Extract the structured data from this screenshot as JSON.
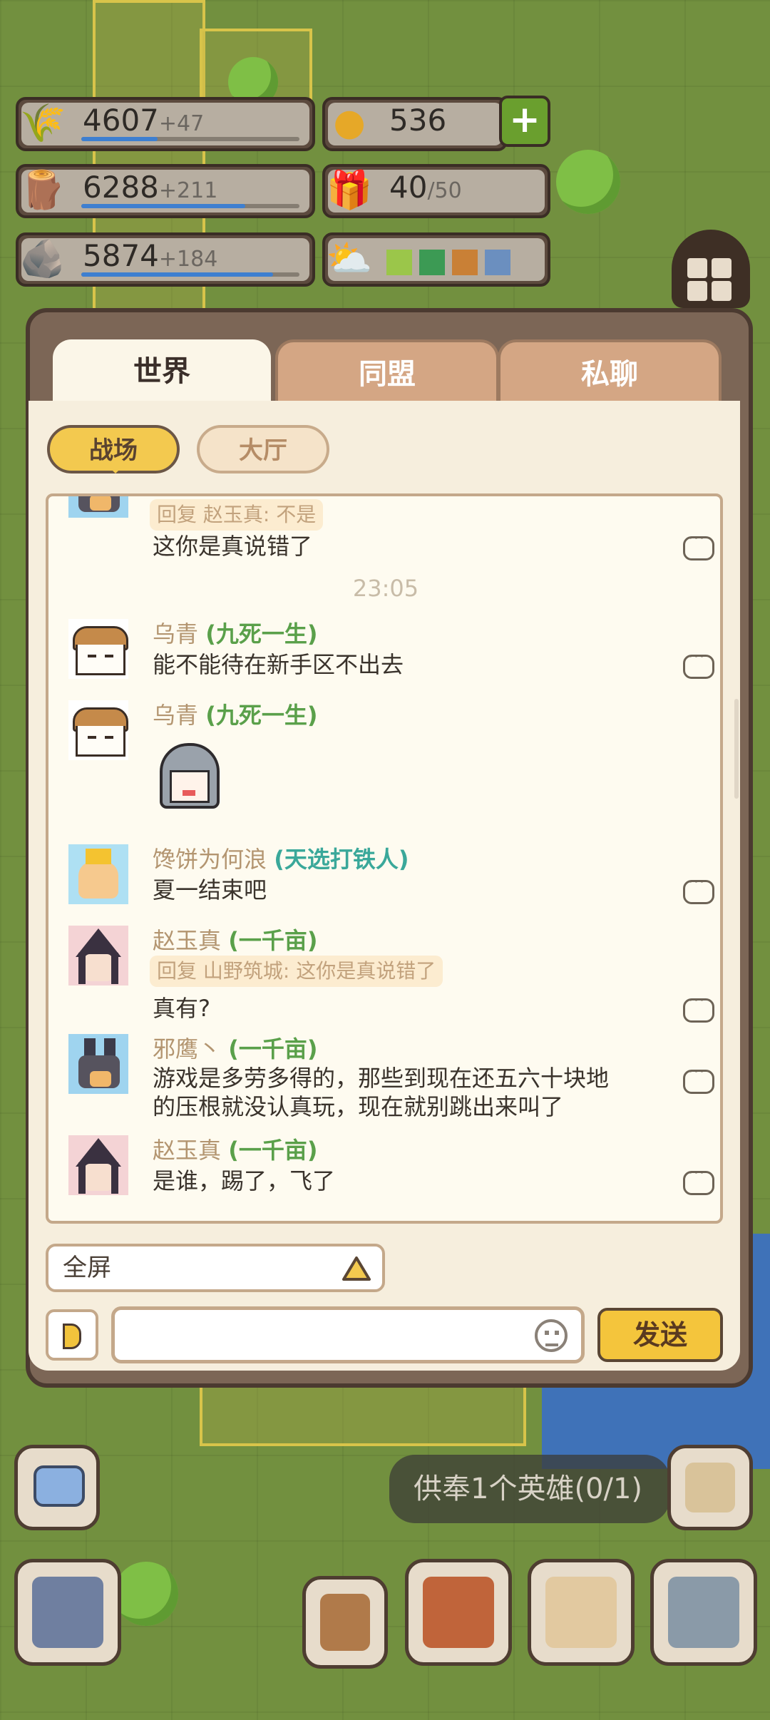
{
  "resources": [
    {
      "name": "food",
      "icon": "wheat-icon",
      "value": "4607",
      "rate": "+47",
      "fill": 0.35
    },
    {
      "name": "wood",
      "icon": "log-icon",
      "value": "6288",
      "rate": "+211",
      "fill": 0.75
    },
    {
      "name": "stone",
      "icon": "stone-icon",
      "value": "5874",
      "rate": "+184",
      "fill": 0.88
    }
  ],
  "gold": {
    "value": "536"
  },
  "gift": {
    "value": "40",
    "max": "/50"
  },
  "weather": {
    "colors": [
      "#9bc64a",
      "#3c9a54",
      "#c98036",
      "#6b8fbf"
    ]
  },
  "chat": {
    "tabs": [
      "世界",
      "同盟",
      "私聊"
    ],
    "active_tab": "世界",
    "channels": [
      "战场",
      "大厅"
    ],
    "active_channel": "战场",
    "messages": [
      {
        "reply": "回复 赵玉真: 不是",
        "text": "这你是真说错了",
        "avatar": "dog"
      },
      {
        "time": "23:05"
      },
      {
        "name": "乌青",
        "title": "(九死一生)",
        "text": "能不能待在新手区不出去",
        "avatar": "acorn"
      },
      {
        "name": "乌青",
        "title": "(九死一生)",
        "sticker": "knight-sticker",
        "avatar": "acorn"
      },
      {
        "name": "馋饼为何浪",
        "title": "(天选打铁人)",
        "text": "夏一结束吧",
        "avatar": "king"
      },
      {
        "name": "赵玉真",
        "title": "(一千亩)",
        "reply": "回复 山野筑城: 这你是真说错了",
        "text": "真有?",
        "avatar": "witch"
      },
      {
        "name": "邪鹰丶",
        "title": "(一千亩)",
        "text_lines": [
          "游戏是多劳多得的，那些到现在还五六十块地",
          "的压根就没认真玩，现在就别跳出来叫了"
        ],
        "avatar": "dog"
      },
      {
        "name": "赵玉真",
        "title": "(一千亩)",
        "text": "是谁，踢了，飞了",
        "avatar": "witch"
      }
    ],
    "fullscreen_label": "全屏",
    "input_placeholder": "",
    "send_label": "发送"
  },
  "colors": {
    "title_green": "#5aa04a",
    "title_teal": "#3aa89a",
    "name_tan": "#b39570"
  },
  "offer_text": "供奉1个英雄(0/1)"
}
